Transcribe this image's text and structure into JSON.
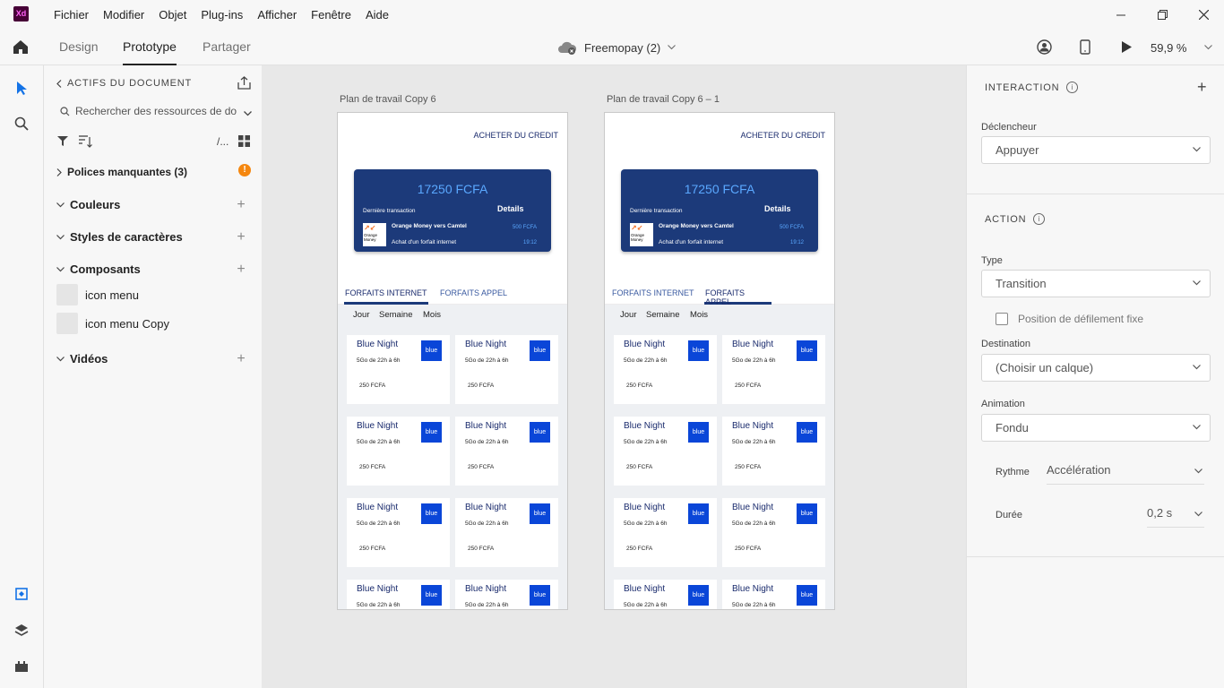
{
  "menubar": {
    "logo": "Xd",
    "items": [
      "Fichier",
      "Modifier",
      "Objet",
      "Plug-ins",
      "Afficher",
      "Fenêtre",
      "Aide"
    ]
  },
  "appbar": {
    "tabs": [
      "Design",
      "Prototype",
      "Partager"
    ],
    "active_tab": "Prototype",
    "doc_title": "Freemopay (2)",
    "zoom": "59,9 %"
  },
  "assets": {
    "header": "ACTIFS DU DOCUMENT",
    "search_placeholder": "Rechercher des ressources de do",
    "filter_text": "/...",
    "missing_fonts": "Polices manquantes (3)",
    "sections": [
      "Couleurs",
      "Styles de caractères",
      "Composants",
      "Vidéos"
    ],
    "components": [
      "icon menu",
      "icon menu Copy"
    ]
  },
  "artboards": [
    {
      "label": "Plan de travail Copy 6",
      "active_tab": 0
    },
    {
      "label": "Plan de travail Copy 6 – 1",
      "active_tab": 1
    }
  ],
  "mockup": {
    "buy_credit": "ACHETER DU CREDIT",
    "balance": "17250 FCFA",
    "last_tx": "Dernière transaction",
    "details": "Details",
    "om_logo": "Orange Money",
    "tx1": "Orange Money vers Camtel",
    "tx1_amount": "500 FCFA",
    "tx2": "Achat d'un forfait internet",
    "tx2_time": "19:12",
    "tab_internet": "FORFAITS INTERNET",
    "tab_appel": "FORFAITS APPEL",
    "periods": [
      "Jour",
      "Semaine",
      "Mois"
    ],
    "offer_name": "Blue Night",
    "offer_desc": "5Go de 22h à 6h",
    "offer_price": "250 FCFA",
    "offer_logo": "blue"
  },
  "props": {
    "interaction_title": "INTERACTION",
    "trigger_label": "Déclencheur",
    "trigger_value": "Appuyer",
    "action_title": "ACTION",
    "type_label": "Type",
    "type_value": "Transition",
    "fixed_scroll": "Position de défilement fixe",
    "dest_label": "Destination",
    "dest_value": "(Choisir un calque)",
    "anim_label": "Animation",
    "anim_value": "Fondu",
    "rhythm_label": "Rythme",
    "rhythm_value": "Accélération",
    "duration_label": "Durée",
    "duration_value": "0,2 s"
  },
  "colors": {
    "card": "#1c3a7a",
    "offer_logo": "#0a46d8",
    "accent": "#1473e6"
  }
}
